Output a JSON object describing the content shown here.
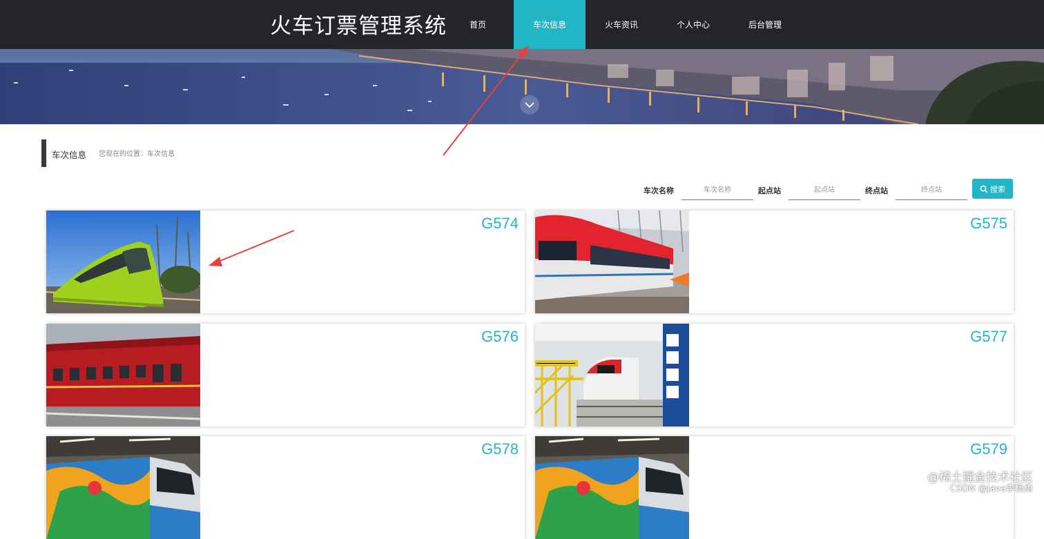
{
  "header": {
    "site_title": "火车订票管理系统",
    "nav": [
      {
        "label": "首页",
        "active": false
      },
      {
        "label": "车次信息",
        "active": true
      },
      {
        "label": "火车资讯",
        "active": false
      },
      {
        "label": "个人中心",
        "active": false
      },
      {
        "label": "后台管理",
        "active": false
      }
    ]
  },
  "section": {
    "title": "车次信息",
    "breadcrumb": "您现在的位置：车次信息"
  },
  "search": {
    "fields": [
      {
        "label": "车次名称",
        "placeholder": "车次名称"
      },
      {
        "label": "起点站",
        "placeholder": "起点站"
      },
      {
        "label": "终点站",
        "placeholder": "终点站"
      }
    ],
    "button_label": "搜索"
  },
  "cards": [
    {
      "title": "G574"
    },
    {
      "title": "G575"
    },
    {
      "title": "G576"
    },
    {
      "title": "G577"
    },
    {
      "title": "G578"
    },
    {
      "title": "G579"
    }
  ],
  "watermark": {
    "line1": "@稀土掘金技术社区",
    "line2": "CSDN @java李杨勇"
  },
  "colors": {
    "accent": "#21b5c6",
    "nav_bg": "#23252b",
    "annotation_arrow": "#e8403a"
  },
  "icons": {
    "scroll_down": "chevron-down-icon",
    "search": "search-icon"
  }
}
